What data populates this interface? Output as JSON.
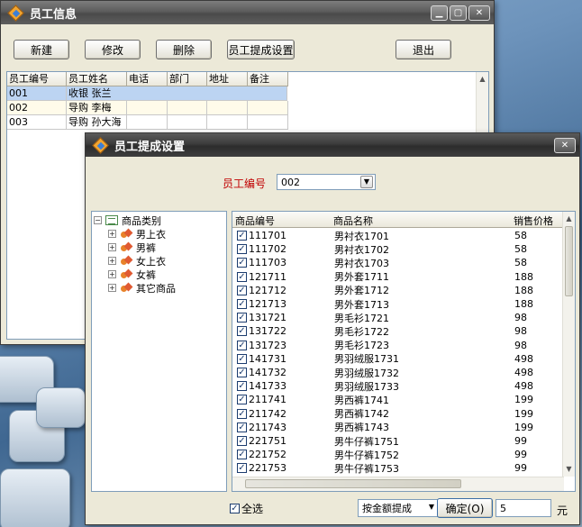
{
  "colors": {
    "accent": "#bcd4f2",
    "label_red": "#c00000",
    "title_bar": "#4a4a4a"
  },
  "main_window": {
    "title": "员工信息",
    "toolbar": {
      "new": "新建",
      "edit": "修改",
      "delete": "删除",
      "commission": "员工提成设置",
      "exit": "退出"
    },
    "columns": [
      "员工编号",
      "员工姓名",
      "电话",
      "部门",
      "地址",
      "备注"
    ],
    "rows": [
      [
        "001",
        "收银 张兰",
        "",
        "",
        "",
        ""
      ],
      [
        "002",
        "导购 李梅",
        "",
        "",
        "",
        ""
      ],
      [
        "003",
        "导购 孙大海",
        "",
        "",
        "",
        ""
      ]
    ]
  },
  "dialog": {
    "title": "员工提成设置",
    "employee_label": "员工编号",
    "employee_value": "002",
    "tree": {
      "root": "商品类别",
      "children": [
        "男上衣",
        "男裤",
        "女上衣",
        "女裤",
        "其它商品"
      ]
    },
    "columns": {
      "code": "商品编号",
      "name": "商品名称",
      "price": "销售价格"
    },
    "products": [
      [
        "111701",
        "男衬衣1701",
        "58"
      ],
      [
        "111702",
        "男衬衣1702",
        "58"
      ],
      [
        "111703",
        "男衬衣1703",
        "58"
      ],
      [
        "121711",
        "男外套1711",
        "188"
      ],
      [
        "121712",
        "男外套1712",
        "188"
      ],
      [
        "121713",
        "男外套1713",
        "188"
      ],
      [
        "131721",
        "男毛衫1721",
        "98"
      ],
      [
        "131722",
        "男毛衫1722",
        "98"
      ],
      [
        "131723",
        "男毛衫1723",
        "98"
      ],
      [
        "141731",
        "男羽绒服1731",
        "498"
      ],
      [
        "141732",
        "男羽绒服1732",
        "498"
      ],
      [
        "141733",
        "男羽绒服1733",
        "498"
      ],
      [
        "211741",
        "男西裤1741",
        "199"
      ],
      [
        "211742",
        "男西裤1742",
        "199"
      ],
      [
        "211743",
        "男西裤1743",
        "199"
      ],
      [
        "221751",
        "男牛仔裤1751",
        "99"
      ],
      [
        "221752",
        "男牛仔裤1752",
        "99"
      ],
      [
        "221753",
        "男牛仔裤1753",
        "99"
      ]
    ],
    "select_all": "全选",
    "mode_value": "按金额提成",
    "ok": "确定(O)",
    "amount_value": "5",
    "unit": "元"
  },
  "icons": {
    "close": "close-icon",
    "minimize": "minimize-icon",
    "maximize": "maximize-icon",
    "dropdown": "chevron-down-icon",
    "check": "check-icon"
  }
}
